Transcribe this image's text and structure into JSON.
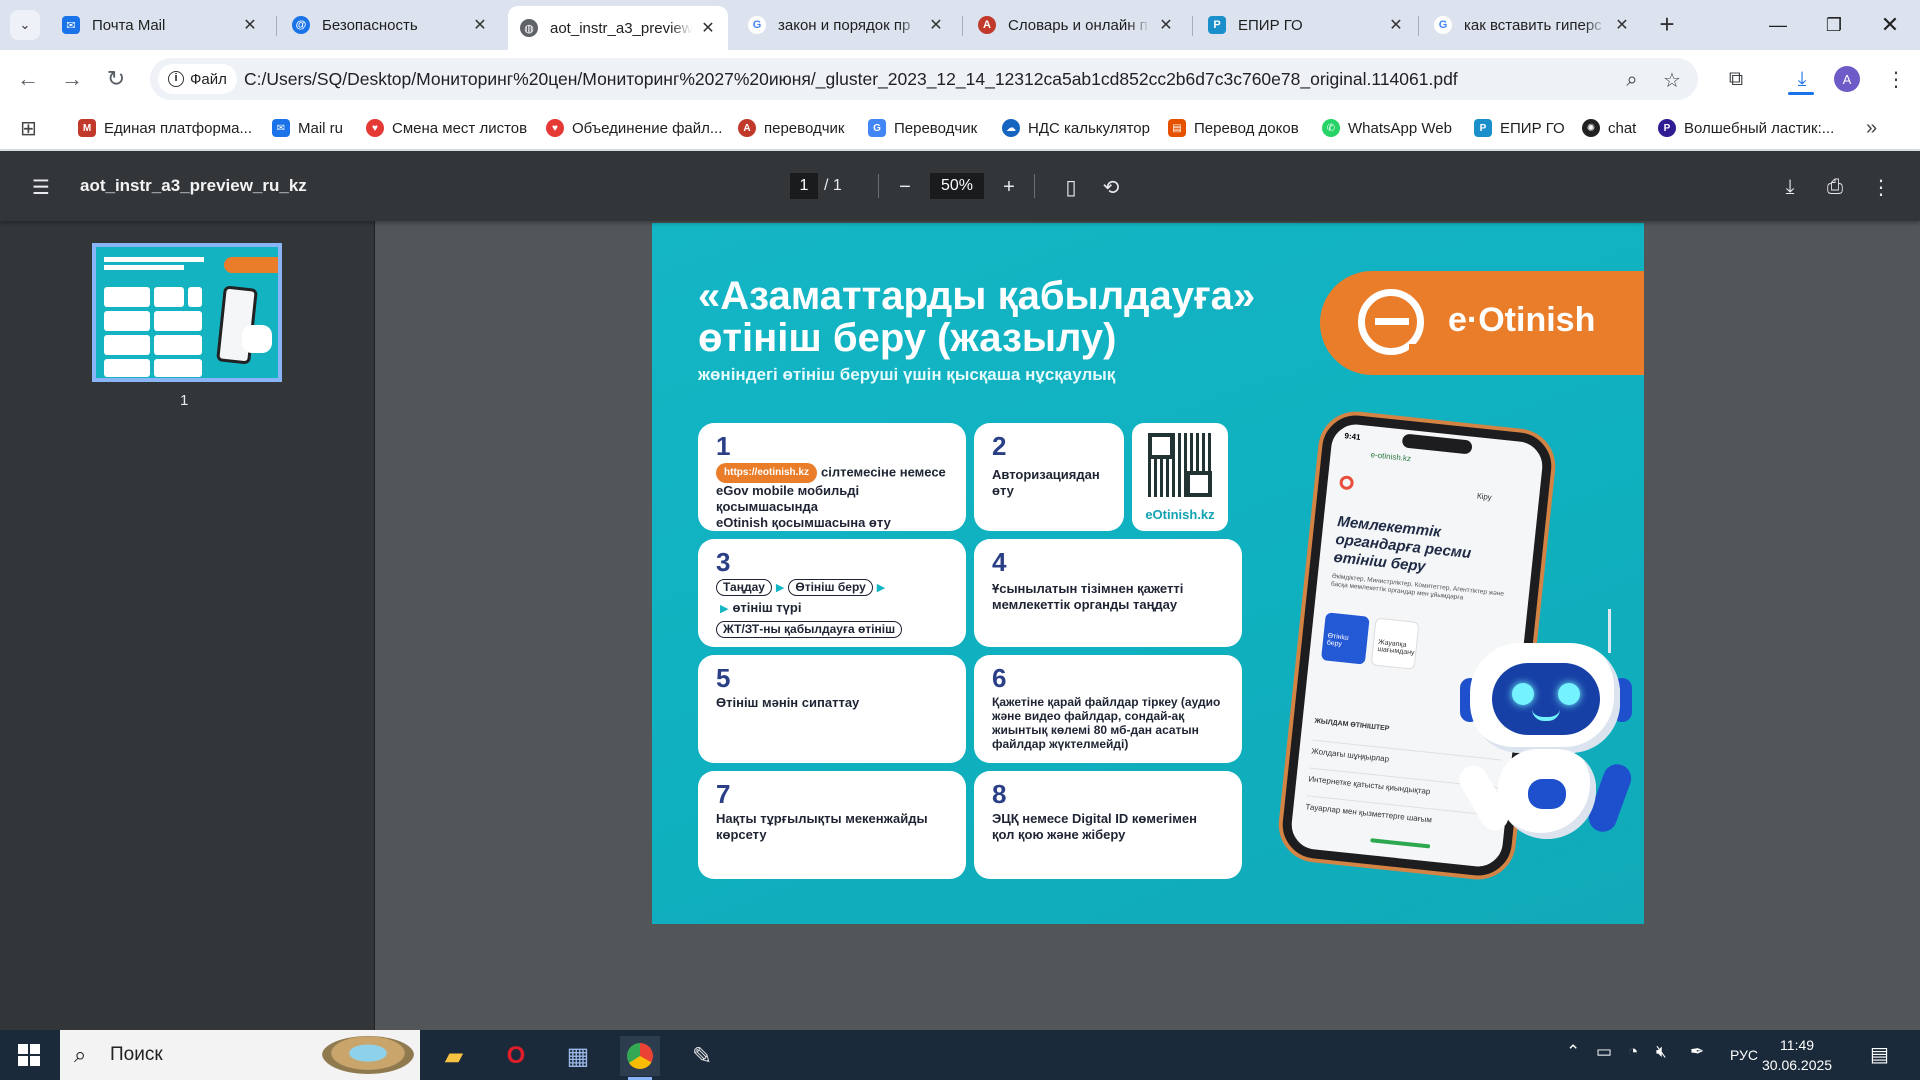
{
  "tabs": [
    {
      "title": "Почта Mail",
      "favicon": "mail-icon",
      "color": "#1a73e8"
    },
    {
      "title": "Безопасность",
      "favicon": "at-icon",
      "color": "#1a73e8"
    },
    {
      "title": "aot_instr_a3_preview_ru_kz",
      "favicon": "globe-icon",
      "color": "#5f6368",
      "active": true
    },
    {
      "title": "закон и порядок пр",
      "favicon": "google-icon",
      "color": "#4285f4"
    },
    {
      "title": "Словарь и онлайн п",
      "favicon": "abbyy-icon",
      "color": "#c0392b"
    },
    {
      "title": "ЕПИР ГО",
      "favicon": "epir-icon",
      "color": "#1a8fc9"
    },
    {
      "title": "как вставить гиперс",
      "favicon": "google-icon",
      "color": "#4285f4"
    }
  ],
  "omnibox": {
    "chip_label": "Файл",
    "url": "C:/Users/SQ/Desktop/Мониторинг%20цен/Мониторинг%2027%20июня/_gluster_2023_12_14_12312ca5ab1cd852cc2b6d7c3c760e78_original.114061.pdf"
  },
  "profile_initial": "A",
  "bookmarks": [
    {
      "label": "Единая платформа...",
      "color": "#c0392b"
    },
    {
      "label": "Mail ru",
      "color": "#1a73e8"
    },
    {
      "label": "Смена мест листов",
      "color": "#e53935"
    },
    {
      "label": "Объединение файл...",
      "color": "#e53935"
    },
    {
      "label": "переводчик",
      "color": "#c0392b"
    },
    {
      "label": "Переводчик",
      "color": "#4285f4"
    },
    {
      "label": "НДС калькулятор",
      "color": "#1565c0"
    },
    {
      "label": "Перевод доков",
      "color": "#e65100"
    },
    {
      "label": "WhatsApp Web",
      "color": "#25d366"
    },
    {
      "label": "ЕПИР ГО",
      "color": "#1a8fc9"
    },
    {
      "label": "chat",
      "color": "#222222"
    },
    {
      "label": "Волшебный ластик:...",
      "color": "#311b92"
    }
  ],
  "pdf": {
    "filename": "aot_instr_a3_preview_ru_kz",
    "page_current": "1",
    "page_total": "/  1",
    "zoom": "50%",
    "thumb_number": "1"
  },
  "doc": {
    "title_line1": "«Азаматтарды қабылдауға»",
    "title_line2": "өтініш беру (жазылу)",
    "subtitle": "жөніндегі өтініш беруші үшін қысқаша нұсқаулық",
    "brand": "e·Otinish",
    "qr_caption": "eOtinish.kz",
    "steps": {
      "s1_num": "1",
      "s1_link": "https://eotinish.kz",
      "s1_text_a": "сілтемесіне немесе",
      "s1_text_b": "eGov mobile мобильді қосымшасында",
      "s1_text_c": "eOtinish қосымшасына өту",
      "s2_num": "2",
      "s2_text": "Авторизациядан өту",
      "s3_num": "3",
      "s3_p1": "Таңдау",
      "s3_p2": "Өтініш беру",
      "s3_t": "өтініш түрі",
      "s3_p3": "ЖТ/ЗТ-ны қабылдауға өтініш",
      "s4_num": "4",
      "s4_text": "Ұсынылатын тізімнен қажетті мемлекеттік органды таңдау",
      "s5_num": "5",
      "s5_text": "Өтініш мәнін сипаттау",
      "s6_num": "6",
      "s6_text": "Қажетіне қарай файлдар тіркеу (аудио және видео файлдар, сондай-ақ жиынтық көлемі 80 мб-дан асатын файлдар жүктелмейді)",
      "s7_num": "7",
      "s7_text": "Нақты тұрғылықты мекенжайды көрсету",
      "s8_num": "8",
      "s8_text": "ЭЦҚ немесе Digital ID көмегімен қол қою және жіберу"
    },
    "phone": {
      "time": "9:41",
      "url": "e-otinish.kz",
      "login": "Кіру",
      "heading": "Мемлекеттік органдарға ресми өтініш беру",
      "desc": "Әкімдіктер, Министрліктер, Комитеттер, Агенттіктер және басқа мемлекеттік органдар мен ұйымдарға",
      "tile1": "Өтініш беру",
      "tile2": "Жауапқа шағымдану",
      "section": "ЖЫЛДАМ ӨТІНІШТЕР",
      "row1": "Жолдағы шұңқырлар",
      "row2": "Интернетке қатысты қиындықтар",
      "row3": "Тауарлар мен қызметтерге шағым"
    }
  },
  "taskbar": {
    "search_label": "Поиск",
    "lang": "РУС",
    "time": "11:49",
    "date": "30.06.2025"
  }
}
